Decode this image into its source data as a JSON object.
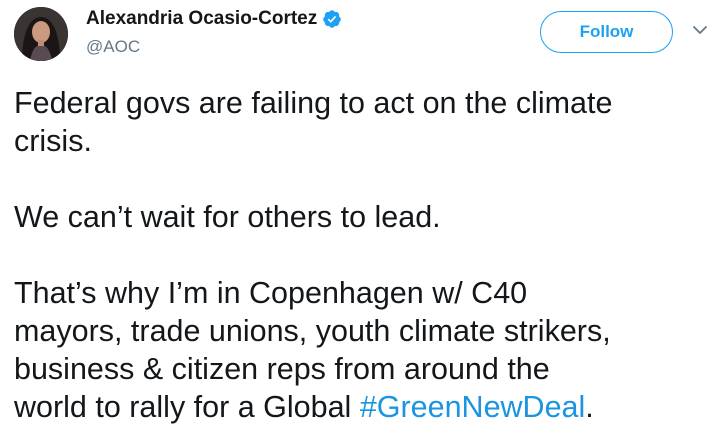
{
  "author": {
    "display_name": "Alexandria Ocasio-Cortez",
    "handle": "@AOC",
    "verified": true,
    "avatar_icon": "profile-photo"
  },
  "actions": {
    "follow_label": "Follow",
    "more_icon": "chevron-down-icon"
  },
  "tweet": {
    "line1": "Federal govs are failing to act on the climate",
    "line2": "crisis.",
    "line3": "We can’t wait for others to lead.",
    "line4": "That’s why I’m in Copenhagen w/ C40",
    "line5": "mayors, trade unions, youth climate strikers,",
    "line6": "business & citizen reps from around the",
    "line7_prefix": "world to rally for a Global ",
    "hashtag": "#GreenNewDeal",
    "line7_suffix": "."
  },
  "colors": {
    "accent": "#1da1f2",
    "hashtag": "#1b95e0",
    "text": "#14171a",
    "secondary": "#657786"
  }
}
